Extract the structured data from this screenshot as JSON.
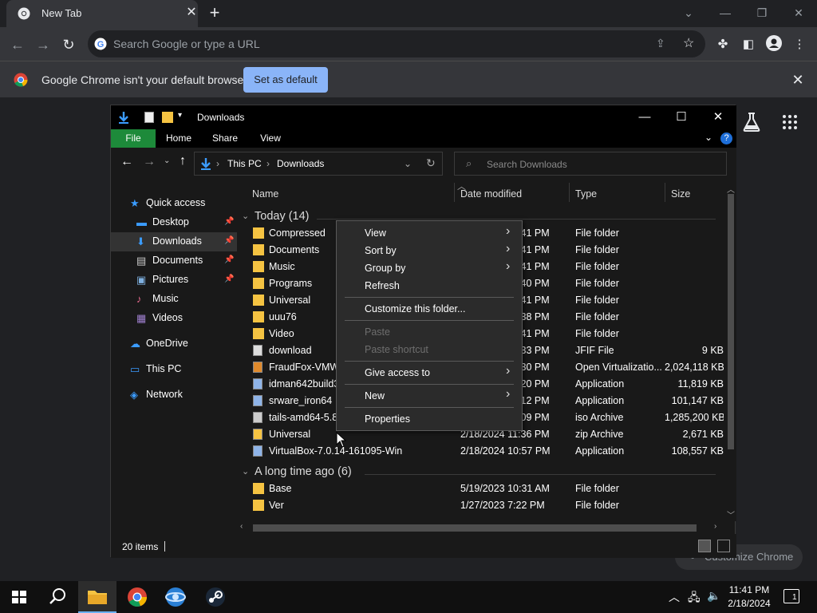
{
  "chrome": {
    "tab_title": "New Tab",
    "omnibox_placeholder": "Search Google or type a URL",
    "infobar_text": "Google Chrome isn't your default browser",
    "set_default_label": "Set as default",
    "customize_label": "Customize Chrome"
  },
  "explorer": {
    "title": "Downloads",
    "ribbon_tabs": [
      "File",
      "Home",
      "Share",
      "View"
    ],
    "breadcrumb": [
      "This PC",
      "Downloads"
    ],
    "search_placeholder": "Search Downloads",
    "nav": [
      {
        "label": "Quick access",
        "icon": "star-icon"
      },
      {
        "label": "Desktop",
        "icon": "desktop-icon",
        "pinned": true
      },
      {
        "label": "Downloads",
        "icon": "download-icon",
        "pinned": true,
        "selected": true
      },
      {
        "label": "Documents",
        "icon": "documents-icon",
        "pinned": true
      },
      {
        "label": "Pictures",
        "icon": "pictures-icon",
        "pinned": true
      },
      {
        "label": "Music",
        "icon": "music-icon"
      },
      {
        "label": "Videos",
        "icon": "videos-icon"
      },
      {
        "label": "OneDrive",
        "icon": "cloud-icon"
      },
      {
        "label": "This PC",
        "icon": "computer-icon"
      },
      {
        "label": "Network",
        "icon": "network-icon"
      }
    ],
    "columns": [
      "Name",
      "Date modified",
      "Type",
      "Size"
    ],
    "groups": [
      {
        "label": "Today (14)",
        "files": [
          {
            "name": "Compressed",
            "date": "2/18/2024 11:41 PM",
            "type": "File folder",
            "size": "",
            "icon": "folder-icon"
          },
          {
            "name": "Documents",
            "date": "2/18/2024 11:41 PM",
            "type": "File folder",
            "size": "",
            "icon": "folder-icon"
          },
          {
            "name": "Music",
            "date": "2/18/2024 11:41 PM",
            "type": "File folder",
            "size": "",
            "icon": "folder-icon"
          },
          {
            "name": "Programs",
            "date": "2/18/2024 11:40 PM",
            "type": "File folder",
            "size": "",
            "icon": "folder-icon"
          },
          {
            "name": "Universal",
            "date": "2/18/2024 11:41 PM",
            "type": "File folder",
            "size": "",
            "icon": "folder-icon"
          },
          {
            "name": "uuu76",
            "date": "2/18/2024 11:38 PM",
            "type": "File folder",
            "size": "",
            "icon": "folder-icon"
          },
          {
            "name": "Video",
            "date": "2/18/2024 11:41 PM",
            "type": "File folder",
            "size": "",
            "icon": "folder-icon"
          },
          {
            "name": "download",
            "date": "2/18/2024 11:33 PM",
            "type": "JFIF File",
            "size": "9 KB",
            "icon": "image-file-icon"
          },
          {
            "name": "FraudFox-VMWare",
            "date": "2/18/2024 11:30 PM",
            "type": "Open Virtualizatio...",
            "size": "2,024,118 KB",
            "icon": "package-icon"
          },
          {
            "name": "idman642build3",
            "date": "2/18/2024 11:20 PM",
            "type": "Application",
            "size": "11,819 KB",
            "icon": "app-icon"
          },
          {
            "name": "srware_iron64",
            "date": "2/18/2024 11:12 PM",
            "type": "Application",
            "size": "101,147 KB",
            "icon": "app-icon"
          },
          {
            "name": "tails-amd64-5.8",
            "date": "2/18/2024 11:09 PM",
            "type": "iso Archive",
            "size": "1,285,200 KB",
            "icon": "iso-icon"
          },
          {
            "name": "Universal",
            "date": "2/18/2024 11:36 PM",
            "type": "zip Archive",
            "size": "2,671 KB",
            "icon": "zip-icon"
          },
          {
            "name": "VirtualBox-7.0.14-161095-Win",
            "date": "2/18/2024 10:57 PM",
            "type": "Application",
            "size": "108,557 KB",
            "icon": "installer-icon"
          }
        ]
      },
      {
        "label": "A long time ago (6)",
        "files": [
          {
            "name": "Base",
            "date": "5/19/2023 10:31 AM",
            "type": "File folder",
            "size": "",
            "icon": "folder-icon"
          },
          {
            "name": "Ver",
            "date": "1/27/2023 7:22 PM",
            "type": "File folder",
            "size": "",
            "icon": "folder-icon"
          }
        ]
      }
    ],
    "status": "20 items"
  },
  "context_menu": {
    "items": [
      {
        "label": "View",
        "submenu": true
      },
      {
        "label": "Sort by",
        "submenu": true
      },
      {
        "label": "Group by",
        "submenu": true
      },
      {
        "label": "Refresh"
      },
      {
        "sep": true
      },
      {
        "label": "Customize this folder..."
      },
      {
        "sep": true
      },
      {
        "label": "Paste",
        "disabled": true
      },
      {
        "label": "Paste shortcut",
        "disabled": true
      },
      {
        "sep": true
      },
      {
        "label": "Give access to",
        "submenu": true
      },
      {
        "sep": true
      },
      {
        "label": "New",
        "submenu": true
      },
      {
        "sep": true
      },
      {
        "label": "Properties"
      }
    ]
  },
  "taskbar": {
    "time": "11:41 PM",
    "date": "2/18/2024",
    "notification_count": "1"
  },
  "colors": {
    "accent": "#8ab4f8",
    "file_tab_green": "#1d8a3a",
    "folder_yellow": "#f5c342"
  }
}
